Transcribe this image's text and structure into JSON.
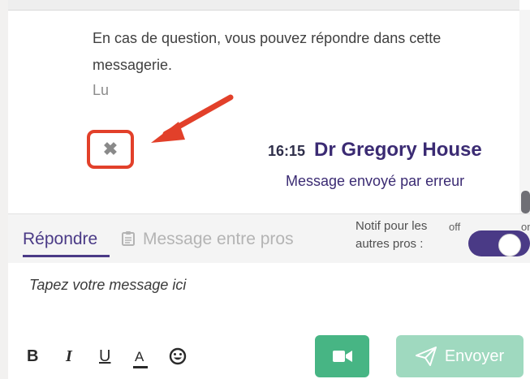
{
  "message": {
    "text": "En cas de question, vous pouvez répondre dans cette messagerie.",
    "status": "Lu",
    "time": "16:15",
    "author": "Dr Gregory House",
    "note": "Message envoyé par erreur"
  },
  "tabs": {
    "reply": "Répondre",
    "pros": "Message entre pros"
  },
  "notif": {
    "label": "Notif pour les autres pros :",
    "off": "off",
    "on": "on",
    "value": "on"
  },
  "composer": {
    "placeholder": "Tapez votre message ici",
    "format": {
      "bold": "B",
      "italic": "I",
      "underline": "U",
      "color": "A"
    },
    "send_label": "Envoyer"
  },
  "icons": {
    "delete": "delete-icon",
    "arrow": "red-arrow",
    "clipboard": "clipboard-icon",
    "emoji": "emoji-icon",
    "video": "video-camera-icon",
    "send": "paper-plane-icon"
  },
  "colors": {
    "accent": "#4a3a86",
    "highlight": "#e2402a",
    "video_button": "#47b584",
    "send_button": "#9fd9bf"
  }
}
